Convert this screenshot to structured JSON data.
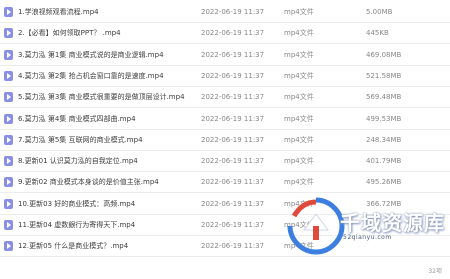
{
  "files": [
    {
      "name": "1.学浪视频观看流程.mp4",
      "date": "2022-06-19 11:37",
      "type": "mp4文件",
      "size": "5.00MB"
    },
    {
      "name": "2.【必看】如何领取PPT？ .mp4",
      "date": "2022-06-19 11:37",
      "type": "mp4文件",
      "size": "445KB"
    },
    {
      "name": "3.莫力泓 第1集 商业模式说的是商业逻辑.mp4",
      "date": "2022-06-19 11:37",
      "type": "mp4文件",
      "size": "469.08MB"
    },
    {
      "name": "4.莫力泓 第2集 抢占机会窗口靠的是速度.mp4",
      "date": "2022-06-19 11:37",
      "type": "mp4文件",
      "size": "521.58MB"
    },
    {
      "name": "5.莫力泓 第3集 商业模式很重要的是做顶层设计.mp4",
      "date": "2022-06-19 11:37",
      "type": "mp4文件",
      "size": "569.48MB"
    },
    {
      "name": "6.莫力泓 第4集 商业模式四部曲.mp4",
      "date": "2022-06-19 11:37",
      "type": "mp4文件",
      "size": "499.53MB"
    },
    {
      "name": "7.莫力泓 第5集 互联网的商业模式.mp4",
      "date": "2022-06-19 11:37",
      "type": "mp4文件",
      "size": "248.34MB"
    },
    {
      "name": "8.更新01 认识莫力泓的自我定位.mp4",
      "date": "2022-06-19 11:37",
      "type": "mp4文件",
      "size": "401.79MB"
    },
    {
      "name": "9.更新02 商业模式本身谈的是价值主张.mp4",
      "date": "2022-06-19 11:37",
      "type": "mp4文件",
      "size": "495.26MB"
    },
    {
      "name": "10.更新03 好的商业模式：高频.mp4",
      "date": "2022-06-19 11:37",
      "type": "mp4文件",
      "size": "366.72MB"
    },
    {
      "name": "11.更新04 虚数銀行为寄得天下.mp4",
      "date": "2022-06-19 11:37",
      "type": "mp4文件",
      "size": ""
    },
    {
      "name": "12.更新05 什么是商业模式？.mp4",
      "date": "2022-06-19 11:37",
      "type": "mp4文件",
      "size": ""
    }
  ],
  "watermark": {
    "title": "千域资源库",
    "url": "52qianyu.com"
  },
  "page_count": "32项",
  "colors": {
    "icon": "#8a8fe6",
    "watermark_blue": "#3d7fe0",
    "watermark_red": "#e04a3b"
  }
}
